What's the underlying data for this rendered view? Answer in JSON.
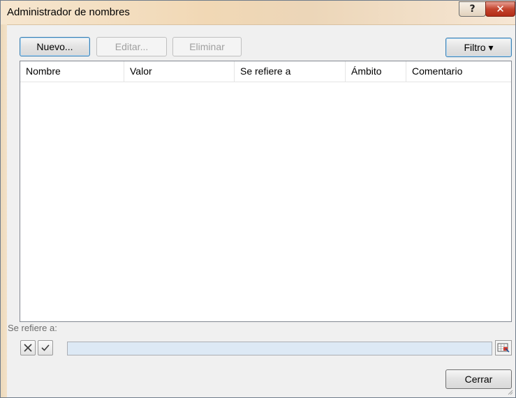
{
  "window": {
    "title": "Administrador de nombres",
    "help_glyph": "?",
    "close_glyph": "✕"
  },
  "toolbar": {
    "new_label": "Nuevo...",
    "edit_label": "Editar...",
    "delete_label": "Eliminar",
    "filter_label": "Filtro ▾"
  },
  "list": {
    "columns": [
      "Nombre",
      "Valor",
      "Se refiere a",
      "Ámbito",
      "Comentario"
    ],
    "rows": []
  },
  "refers_to": {
    "label": "Se refiere a:",
    "value": ""
  },
  "footer": {
    "close_label": "Cerrar"
  }
}
